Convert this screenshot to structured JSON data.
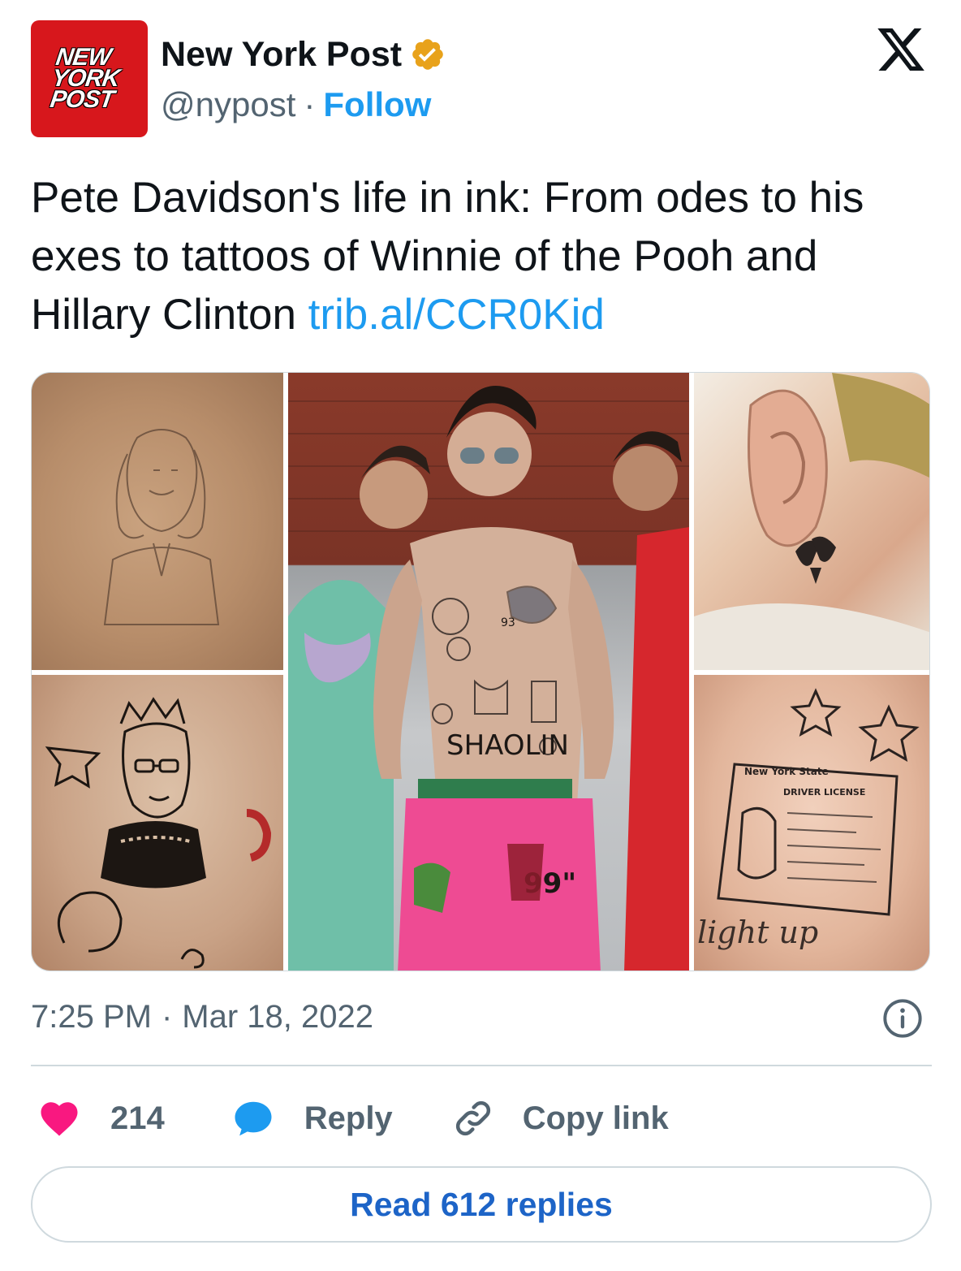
{
  "account": {
    "avatar_lines": [
      "NEW",
      "YORK",
      "POST"
    ],
    "display_name": "New York Post",
    "handle": "@nypost",
    "separator": "·",
    "follow_label": "Follow",
    "verified_color": "#e8a21b"
  },
  "tweet": {
    "text": "Pete Davidson's life in ink: From odes to his exes to tattoos of Winnie of the Pooh and Hillary Clinton ",
    "link": "trib.al/CCR0Kid",
    "time": "7:25 PM",
    "separator": "·",
    "date": "Mar 18, 2022"
  },
  "media": {
    "tattoo_text_shaolin": "SHAOLIN",
    "tattoo_text_93": "93",
    "tattoo_text_99": "99\"",
    "tattoo_text_license_state": "New York State",
    "tattoo_text_license": "DRIVER LICENSE",
    "tattoo_text_light_up": "light up"
  },
  "actions": {
    "like_count": "214",
    "reply_label": "Reply",
    "copy_label": "Copy link",
    "read_replies_label": "Read 612 replies"
  },
  "colors": {
    "brand_red": "#d7171c",
    "link_blue": "#1d9bf0",
    "heart_pink": "#f91880",
    "text_gray": "#536471"
  },
  "icons": [
    "x-logo-icon",
    "verified-badge-icon",
    "info-icon",
    "heart-icon",
    "reply-bubble-icon",
    "link-icon"
  ]
}
